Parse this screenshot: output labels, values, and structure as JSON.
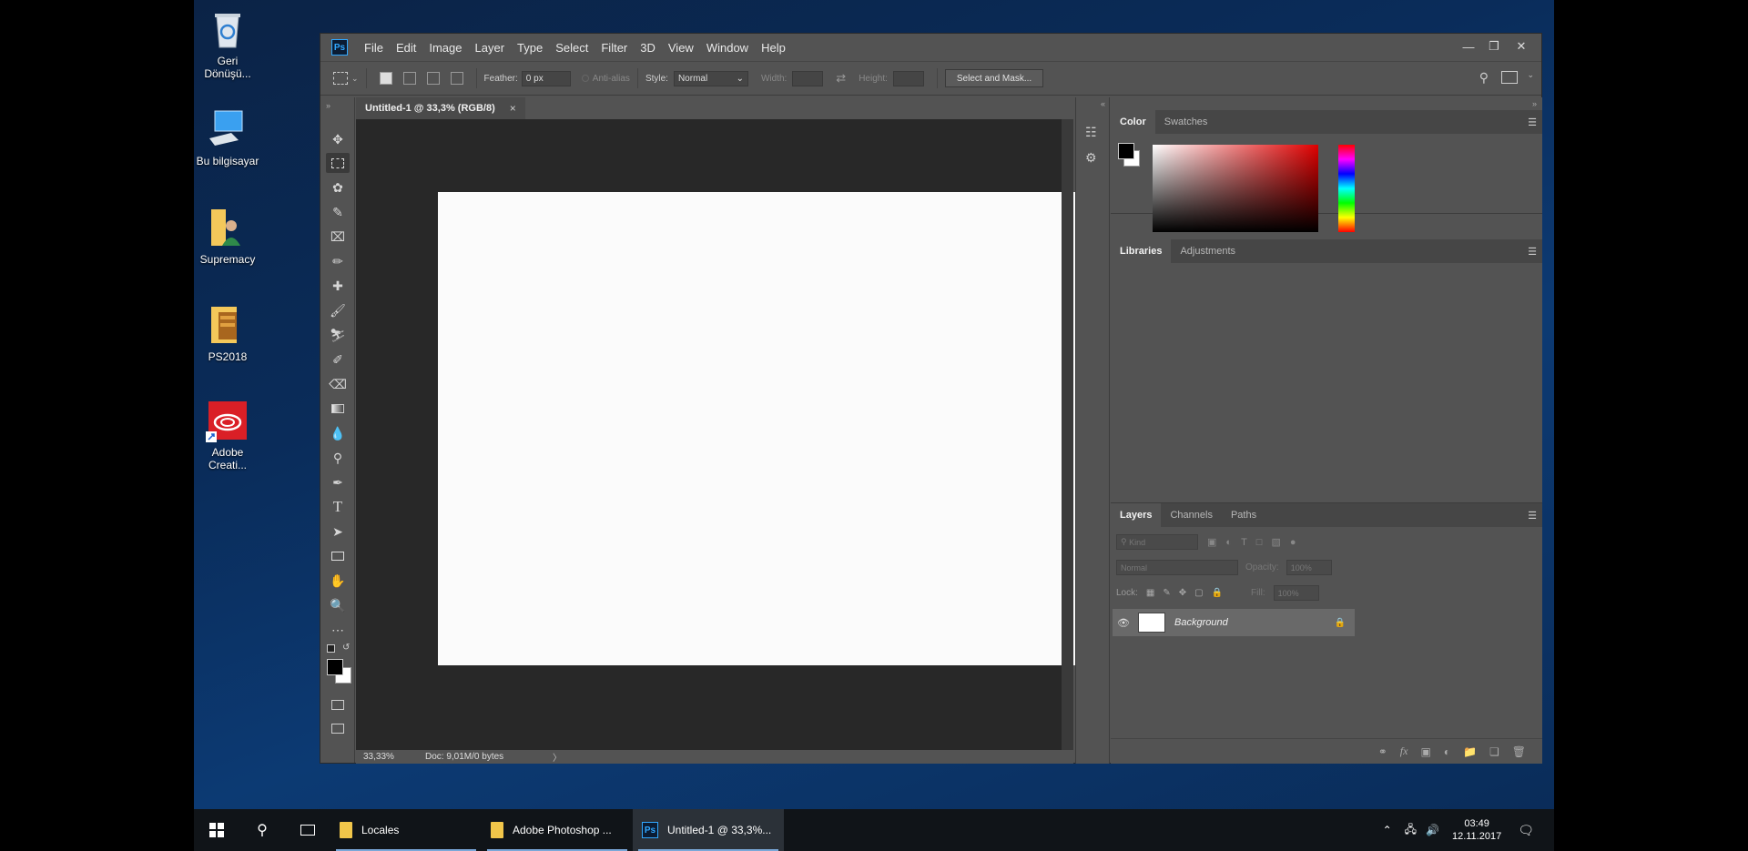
{
  "desktop": {
    "icons": [
      {
        "label": "Geri Dönüşü...",
        "icon": "recycle-bin-icon"
      },
      {
        "label": "Bu bilgisayar",
        "icon": "computer-icon"
      },
      {
        "label": "Supremacy",
        "icon": "user-folder-icon"
      },
      {
        "label": "PS2018",
        "icon": "folder-icon"
      },
      {
        "label": "Adobe Creati...",
        "icon": "creative-cloud-icon"
      }
    ]
  },
  "photoshop": {
    "logo": "Ps",
    "menu": [
      "File",
      "Edit",
      "Image",
      "Layer",
      "Type",
      "Select",
      "Filter",
      "3D",
      "View",
      "Window",
      "Help"
    ],
    "options": {
      "feather_label": "Feather:",
      "feather_value": "0 px",
      "antialias_label": "Anti-alias",
      "style_label": "Style:",
      "style_value": "Normal",
      "width_label": "Width:",
      "height_label": "Height:",
      "select_mask_label": "Select and Mask..."
    },
    "document": {
      "tab_title": "Untitled-1 @ 33,3% (RGB/8)",
      "close_glyph": "×",
      "zoom": "33,33%",
      "doc_info": "Doc: 9,01M/0 bytes",
      "canvas_color": "#fbfbfb"
    },
    "panels": {
      "color_tabs": [
        "Color",
        "Swatches"
      ],
      "libraries_tabs": [
        "Libraries",
        "Adjustments"
      ],
      "layers_tabs": [
        "Layers",
        "Channels",
        "Paths"
      ],
      "kind_placeholder": "Kind",
      "blend_mode": "Normal",
      "opacity_label": "Opacity:",
      "opacity_value": "100%",
      "lock_label": "Lock:",
      "fill_label": "Fill:",
      "fill_value": "100%",
      "layer_name": "Background"
    }
  },
  "taskbar": {
    "apps": [
      "Locales",
      "Adobe Photoshop ...",
      "Untitled-1 @ 33,3%..."
    ],
    "time": "03:49",
    "date": "12.11.2017"
  },
  "colors": {
    "ps_accent": "#31a8ff",
    "panel_bg": "#535353",
    "pasteboard": "#282828"
  }
}
